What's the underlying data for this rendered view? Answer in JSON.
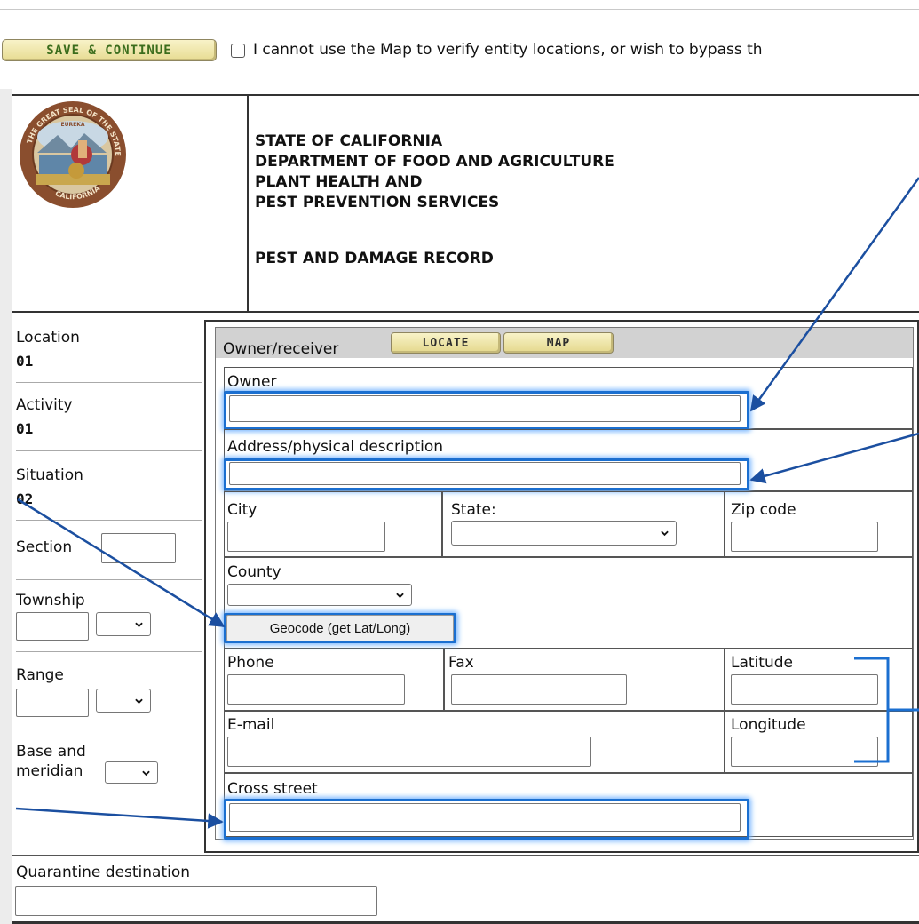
{
  "toolbar": {
    "save_label": "SAVE & CONTINUE",
    "bypass_text": "I cannot use the Map to verify entity locations, or wish to bypass th"
  },
  "header": {
    "line1": "STATE OF CALIFORNIA",
    "line2": "DEPARTMENT OF FOOD AND AGRICULTURE",
    "line3": "PLANT HEALTH AND",
    "line4": "PEST PREVENTION SERVICES",
    "record_title": "PEST AND DAMAGE RECORD",
    "seal_text_top": "THE GREAT SEAL OF THE STATE OF",
    "seal_text_bottom": "CALIFORNIA",
    "seal_motto": "EUREKA"
  },
  "left": {
    "location_label": "Location",
    "location_value": "01",
    "activity_label": "Activity",
    "activity_value": "01",
    "situation_label": "Situation",
    "situation_value": "02",
    "section_label": "Section",
    "township_label": "Township",
    "range_label": "Range",
    "base_label": "Base and",
    "meridian_label": "meridian"
  },
  "form": {
    "owner_receiver": "Owner/receiver",
    "locate_label": "LOCATE",
    "map_label": "MAP",
    "owner_label": "Owner",
    "address_label": "Address/physical description",
    "city_label": "City",
    "state_label": "State:",
    "zip_label": "Zip code",
    "county_label": "County",
    "geocode_label": "Geocode (get Lat/Long)",
    "phone_label": "Phone",
    "fax_label": "Fax",
    "latitude_label": "Latitude",
    "email_label": "E-mail",
    "longitude_label": "Longitude",
    "cross_street_label": "Cross street"
  },
  "bottom": {
    "quarantine_label": "Quarantine destination"
  },
  "colors": {
    "highlight": "#1b6fd0",
    "button_bg": "#efe6a8",
    "save_text": "#3b6d1c"
  }
}
